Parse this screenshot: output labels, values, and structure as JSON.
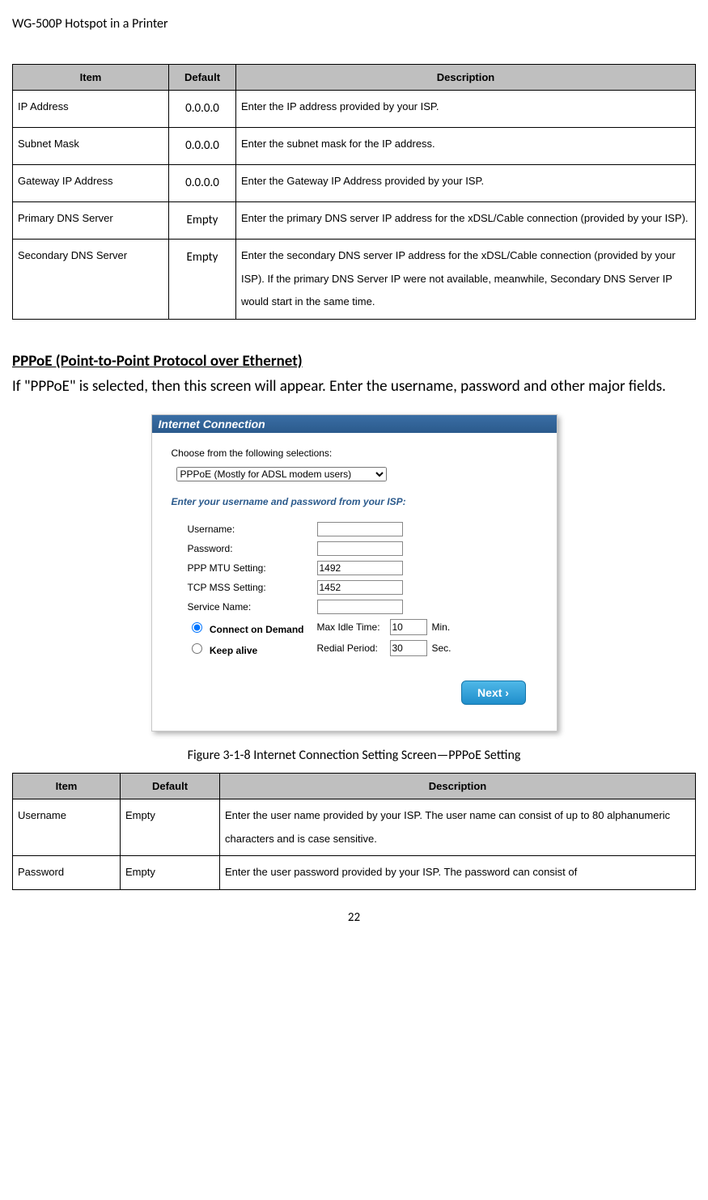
{
  "header": "WG-500P Hotspot in a Printer",
  "table1": {
    "headers": [
      "Item",
      "Default",
      "Description"
    ],
    "rows": [
      {
        "item": "IP Address",
        "def": "0.0.0.0",
        "desc": "Enter the IP address provided by your ISP."
      },
      {
        "item": "Subnet Mask",
        "def": "0.0.0.0",
        "desc": "Enter the subnet mask for the IP address."
      },
      {
        "item": "Gateway IP Address",
        "def": "0.0.0.0",
        "desc": "Enter the Gateway IP Address provided by your ISP."
      },
      {
        "item": "Primary DNS Server",
        "def": "Empty",
        "desc": "Enter the primary DNS server IP address for the xDSL/Cable connection (provided by your ISP)."
      },
      {
        "item": "Secondary DNS Server",
        "def": "Empty",
        "desc": "Enter the secondary DNS server IP address for the xDSL/Cable connection (provided by your ISP). If the primary DNS Server IP were not available, meanwhile, Secondary DNS Server IP would start in the same time."
      }
    ]
  },
  "section": {
    "title": "PPPoE (Point-to-Point Protocol over Ethernet)",
    "body": "If \"PPPoE\" is selected, then this screen will appear. Enter the username, password and other major fields."
  },
  "panel": {
    "title": "Internet Connection",
    "choose_label": "Choose from the following selections:",
    "select_value": "PPPoE (Mostly for ADSL modem users)",
    "blue_label": "Enter your username and password from your ISP:",
    "fields": {
      "username": {
        "label": "Username:"
      },
      "password": {
        "label": "Password:"
      },
      "mtu": {
        "label": "PPP MTU Setting:",
        "value": "1492"
      },
      "mss": {
        "label": "TCP MSS Setting:",
        "value": "1452"
      },
      "service": {
        "label": "Service Name:"
      }
    },
    "radio1": {
      "label": "Connect on Demand",
      "sub": "Max Idle Time:",
      "value": "10",
      "unit": "Min."
    },
    "radio2": {
      "label": "Keep alive",
      "sub": "Redial Period:",
      "value": "30",
      "unit": "Sec."
    },
    "next": "Next ›"
  },
  "figure_caption": "Figure 3-1-8 Internet Connection Setting Screen—PPPoE Setting",
  "table2": {
    "headers": [
      "Item",
      "Default",
      "Description"
    ],
    "rows": [
      {
        "item": "Username",
        "def": "Empty",
        "desc": "Enter the user name provided by your ISP. The user name can consist of up to 80 alphanumeric characters and is case sensitive."
      },
      {
        "item": "Password",
        "def": "Empty",
        "desc": "Enter the user password provided by your ISP. The password can consist of"
      }
    ]
  },
  "page_number": "22"
}
